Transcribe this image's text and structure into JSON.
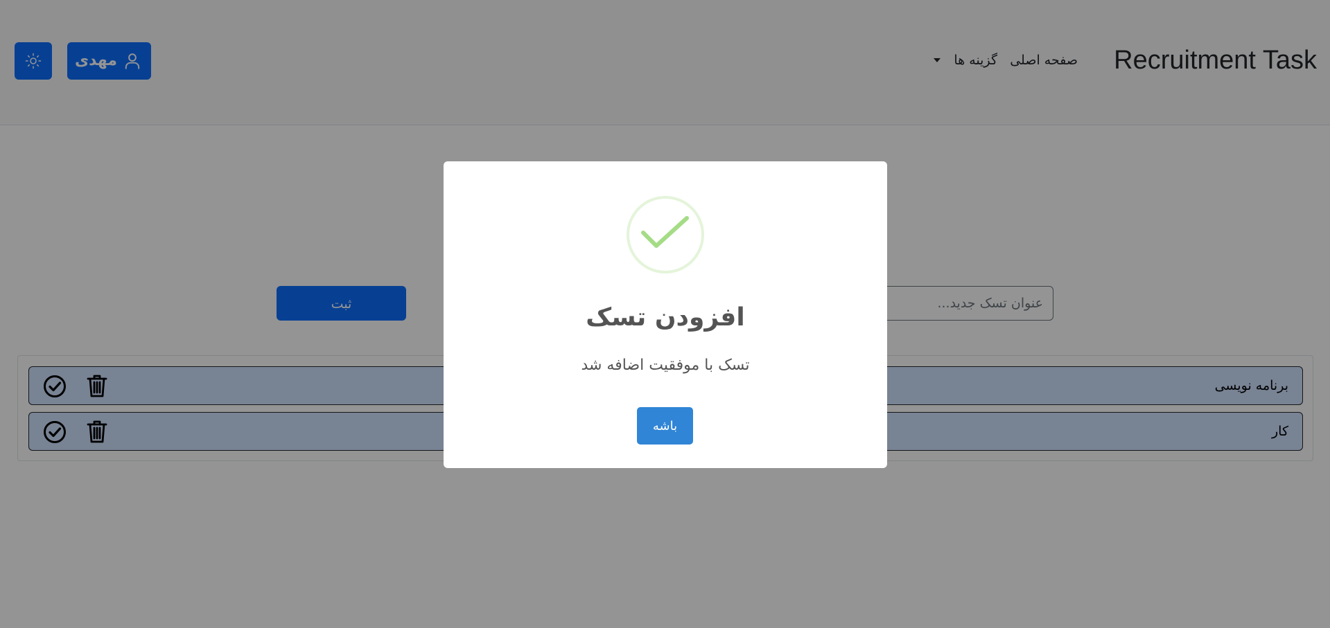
{
  "navbar": {
    "brand": "Recruitment Task",
    "home_link": "صفحه اصلی",
    "options_dropdown": "گزینه ها",
    "user_button_label": "مهدی",
    "user_icon": "person-icon",
    "theme_icon": "sun-icon",
    "dropdown_icon": "caret-down-icon"
  },
  "task_form": {
    "input_placeholder": "عنوان تسک جدید...",
    "input_value": "",
    "submit_label": "ثبت"
  },
  "tasks": [
    {
      "title": "برنامه نویسی",
      "complete_icon": "check-circle-icon",
      "delete_icon": "trash-icon"
    },
    {
      "title": "کار",
      "complete_icon": "check-circle-icon",
      "delete_icon": "trash-icon"
    }
  ],
  "modal": {
    "icon": "success-check-icon",
    "title": "افزودن تسک",
    "text": "تسک با موفقیت اضافه شد",
    "confirm_label": "باشه"
  },
  "colors": {
    "primary": "#0d6efd",
    "navbar_bg": "#f8f9fa",
    "task_row_bg": "#cfe2ff",
    "modal_confirm": "#3085d6",
    "success_green": "#a5dc86"
  }
}
